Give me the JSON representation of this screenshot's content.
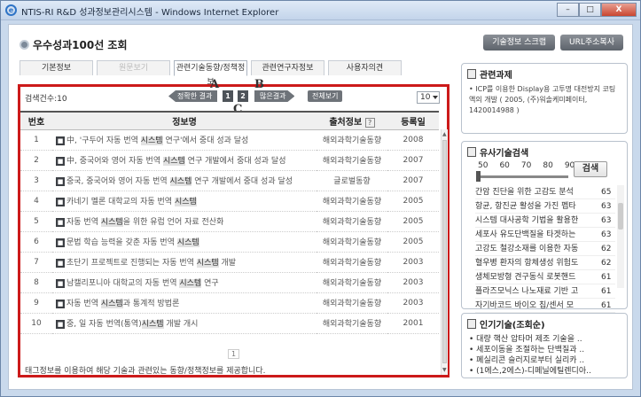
{
  "window": {
    "title": "NTIS-RI R&D 성과정보관리시스템 - Windows Internet Explorer",
    "icon": "ie-icon",
    "buttons": {
      "minimize": "–",
      "maximize": "□",
      "close": "X"
    }
  },
  "page": {
    "title": "우수성과100선 조회",
    "top_buttons": [
      "기술정보 스크랩",
      "URL주소복사"
    ]
  },
  "tabs": [
    {
      "label": "기본정보",
      "state": "normal"
    },
    {
      "label": "원문보기",
      "state": "disabled"
    },
    {
      "label": "관련기술동향/정책정보",
      "state": "active"
    },
    {
      "label": "관련연구자정보",
      "state": "normal"
    },
    {
      "label": "사용자의견",
      "state": "normal"
    }
  ],
  "results": {
    "count_label": "검색건수:10",
    "prev_label": "정확한 결과",
    "pages": [
      "1",
      "2"
    ],
    "next_label": "많은결과",
    "all_label": "전체보기",
    "per_page": "10",
    "annotations": {
      "a": "A",
      "b": "B",
      "c": "C"
    },
    "columns": {
      "num": "번호",
      "title": "정보명",
      "source": "출처정보",
      "help": "?",
      "year": "등록일"
    },
    "rows": [
      {
        "num": "1",
        "pre": "中, '구두어 자동 번역 ",
        "hl": "시스템",
        "post": " 연구'에서 중대 성과 달성",
        "source": "해외과학기술동향",
        "year": "2008"
      },
      {
        "num": "2",
        "pre": "中, 중국어와 영어 자동 번역 ",
        "hl": "시스템",
        "post": " 연구 개발에서 중대 성과 달성",
        "source": "해외과학기술동향",
        "year": "2007"
      },
      {
        "num": "3",
        "pre": "중국, 중국어와 영어 자동 번역 ",
        "hl": "시스템",
        "post": " 연구 개발에서 중대 성과 달성",
        "source": "글로벌동향",
        "year": "2007"
      },
      {
        "num": "4",
        "pre": "카네기 멜론 대학교의 자동 번역 ",
        "hl": "시스템",
        "post": "",
        "source": "해외과학기술동향",
        "year": "2005"
      },
      {
        "num": "5",
        "pre": "자동 번역 ",
        "hl": "시스템",
        "post": "을 위한 유럽 언어 자료 전산화",
        "source": "해외과학기술동향",
        "year": "2005"
      },
      {
        "num": "6",
        "pre": "문법 학습 능력을 갖춘 자동 번역 ",
        "hl": "시스템",
        "post": "",
        "source": "해외과학기술동향",
        "year": "2005"
      },
      {
        "num": "7",
        "pre": "초단기 프로젝트로 진행되는 자동 번역 ",
        "hl": "시스템",
        "post": " 개발",
        "source": "해외과학기술동향",
        "year": "2003"
      },
      {
        "num": "8",
        "pre": "남캘리포니아 대학교의 자동 번역 ",
        "hl": "시스템",
        "post": " 연구",
        "source": "해외과학기술동향",
        "year": "2003"
      },
      {
        "num": "9",
        "pre": "자동 번역 ",
        "hl": "시스템",
        "post": "과 통계적 방법론",
        "source": "해외과학기술동향",
        "year": "2003"
      },
      {
        "num": "10",
        "pre": "중, 일 자동 번역(통역)",
        "hl": "시스템",
        "post": " 개발 개시",
        "source": "해외과학기술동향",
        "year": "2001"
      }
    ],
    "pager": "1",
    "footer_note": "태그정보를 이용하여 해당 기술과 관련있는 동향/정책정보를 제공합니다."
  },
  "related": {
    "title": "관련과제",
    "text": "• ICP를 이용한 Display용 고투명 대전방지 코팅액의 개발 ( 2005, (주)워솔케미페이터, 1420014988 )"
  },
  "similar": {
    "title": "유사기술검색",
    "ticks": [
      "50",
      "60",
      "70",
      "80",
      "90"
    ],
    "slider_value": 50,
    "search_label": "검색",
    "items": [
      {
        "title": "간암 진단을 위한 고감도 분석",
        "score": "65"
      },
      {
        "title": "항균, 항진균 활성을 가진 펩타",
        "score": "63"
      },
      {
        "title": "시스템 대사공학 기법을 활용한",
        "score": "63"
      },
      {
        "title": "세포사 유도단백질을 타겟하는",
        "score": "63"
      },
      {
        "title": "고강도 철강소재를 이용한 자동",
        "score": "62"
      },
      {
        "title": "혈우병 환자의 항체생성 위험도",
        "score": "62"
      },
      {
        "title": "생체모방형 견구동식 로봇핸드",
        "score": "61"
      },
      {
        "title": "플라즈모닉스 나노재료 기반 고",
        "score": "61"
      },
      {
        "title": "자기바코드 바이오 칩/센서 모",
        "score": "61"
      }
    ]
  },
  "hot": {
    "title": "인기기술(조회순)",
    "items": [
      "• 대량 핵산 압타머 제조 기술을 ..",
      "• 세포이동을 조절하는 단백질과 ..",
      "• 폐실리콘 슬러지로부터 실리카 ..",
      "• (1에스,2에스)-디페닐에틸렌디아.."
    ]
  }
}
